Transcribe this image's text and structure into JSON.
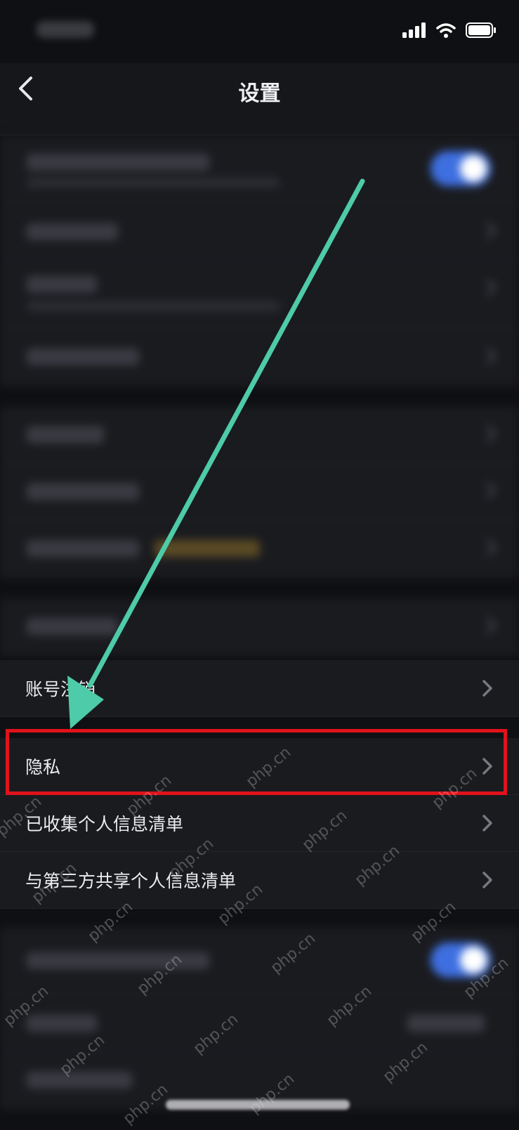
{
  "header": {
    "title": "设置"
  },
  "visible_rows": [
    {
      "label": "账号注销"
    },
    {
      "label": "隐私"
    },
    {
      "label": "已收集个人信息清单"
    },
    {
      "label": "与第三方共享个人信息清单"
    }
  ],
  "watermark": "php.cn",
  "colors": {
    "highlight": "#e0121b",
    "arrow": "#4ecba8",
    "toggle": "#3e6fe0"
  },
  "icons": {
    "back": "chevron-left-icon",
    "row": "chevron-right-icon"
  }
}
